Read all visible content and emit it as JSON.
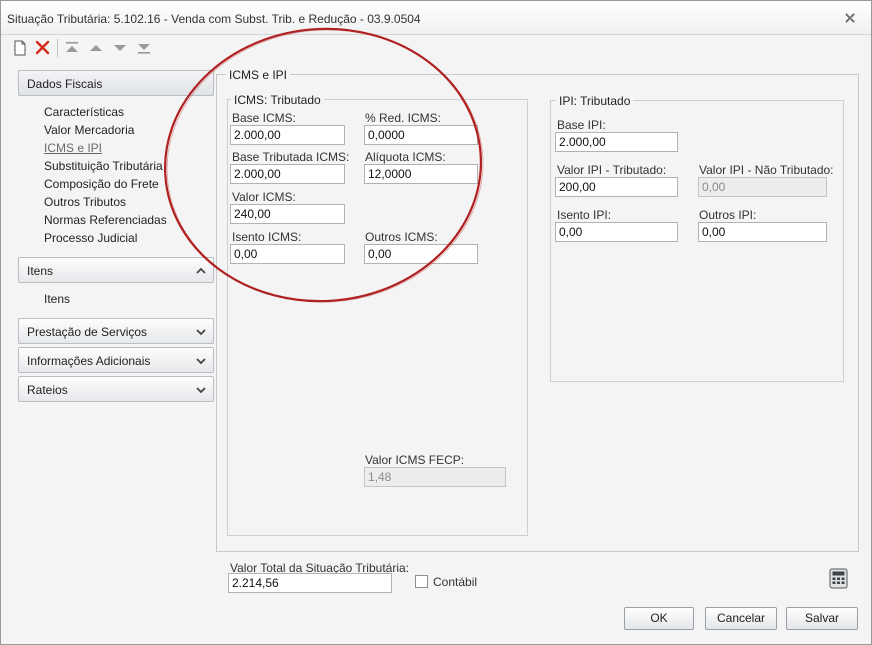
{
  "window": {
    "title": "Situação Tributária: 5.102.16 - Venda com Subst. Trib. e Redução - 03.9.0504",
    "close_icon": "close-x-icon"
  },
  "toolbar": {
    "icons": [
      "new-document-icon",
      "delete-icon",
      "move-first-icon",
      "move-up-icon",
      "move-down-icon",
      "move-last-icon"
    ]
  },
  "sidebar": {
    "dados_fiscais": {
      "header": "Dados Fiscais",
      "items": [
        "Características",
        "Valor Mercadoria",
        "ICMS e IPI",
        "Substituição Tributária",
        "Composição do Frete",
        "Outros Tributos",
        "Normas Referenciadas",
        "Processo Judicial"
      ],
      "selected_index": 2
    },
    "itens": {
      "header": "Itens",
      "items": [
        "Itens"
      ]
    },
    "prestacao": {
      "header": "Prestação de Serviços"
    },
    "informacoes": {
      "header": "Informações Adicionais"
    },
    "rateios": {
      "header": "Rateios"
    }
  },
  "main": {
    "section_title": "ICMS e IPI",
    "icms": {
      "title": "ICMS: Tributado",
      "base_icms_label": "Base ICMS:",
      "base_icms_value": "2.000,00",
      "red_icms_label": "% Red. ICMS:",
      "red_icms_value": "0,0000",
      "base_tributada_label": "Base Tributada ICMS:",
      "base_tributada_value": "2.000,00",
      "aliquota_label": "Alíquota ICMS:",
      "aliquota_value": "12,0000",
      "valor_icms_label": "Valor ICMS:",
      "valor_icms_value": "240,00",
      "isento_label": "Isento ICMS:",
      "isento_value": "0,00",
      "outros_label": "Outros ICMS:",
      "outros_value": "0,00",
      "fecp_label": "Valor ICMS FECP:",
      "fecp_value": "1,48"
    },
    "ipi": {
      "title": "IPI: Tributado",
      "base_ipi_label": "Base IPI:",
      "base_ipi_value": "2.000,00",
      "tributado_label": "Valor IPI - Tributado:",
      "tributado_value": "200,00",
      "nao_tributado_label": "Valor IPI - Não Tributado:",
      "nao_tributado_value": "0,00",
      "isento_label": "Isento IPI:",
      "isento_value": "0,00",
      "outros_label": "Outros IPI:",
      "outros_value": "0,00"
    }
  },
  "footer": {
    "total_label": "Valor Total da Situação Tributária:",
    "total_value": "2.214,56",
    "contabil_label": "Contábil",
    "contabil_checked": false,
    "calculator_icon": "calculator-icon",
    "ok_label": "OK",
    "cancel_label": "Cancelar",
    "save_label": "Salvar"
  },
  "colors": {
    "annotation_ellipse": "#b02020",
    "delete_icon": "#d42a1c"
  }
}
